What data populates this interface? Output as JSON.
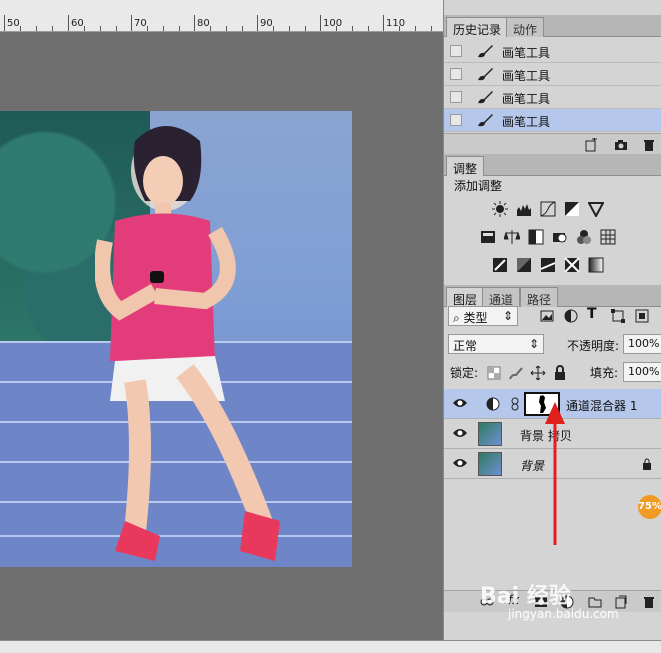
{
  "ruler": {
    "labels": [
      "50",
      "60",
      "70",
      "80",
      "90",
      "100",
      "110"
    ]
  },
  "history_panel": {
    "tabs": [
      "历史记录",
      "动作"
    ],
    "items": [
      {
        "label": "画笔工具",
        "selected": false
      },
      {
        "label": "画笔工具",
        "selected": false
      },
      {
        "label": "画笔工具",
        "selected": false
      },
      {
        "label": "画笔工具",
        "selected": true
      }
    ]
  },
  "adjustments_panel": {
    "tab": "调整",
    "title": "添加调整"
  },
  "layers_panel": {
    "tabs": [
      "图层",
      "通道",
      "路径"
    ],
    "filter_kind": "类型",
    "blend_mode": "正常",
    "opacity_label": "不透明度:",
    "opacity_value": "100%",
    "lock_label": "锁定:",
    "fill_label": "填充:",
    "fill_value": "100%",
    "layers": [
      {
        "name": "通道混合器 1",
        "selected": true
      },
      {
        "name": "背景 拷贝",
        "selected": false
      },
      {
        "name": "背景",
        "selected": false
      }
    ]
  },
  "badge": "75%",
  "watermark": {
    "brand": "Bai 经验",
    "url": "jingyan.baidu.com"
  },
  "colors": {
    "selection": "#b5c7ea",
    "arrow": "#e0201c",
    "badge": "#f29a26"
  }
}
